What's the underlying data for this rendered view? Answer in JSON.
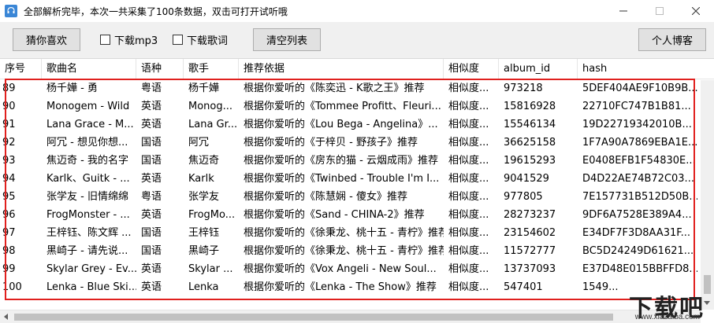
{
  "window": {
    "title": "全部解析完毕，本次一共采集了100条数据，双击可打开试听哦"
  },
  "toolbar": {
    "guess_label": "猜你喜欢",
    "download_mp3_label": "下载mp3",
    "download_mp3_checked": false,
    "download_lyrics_label": "下载歌词",
    "download_lyrics_checked": false,
    "clear_label": "清空列表",
    "blog_label": "个人博客"
  },
  "table": {
    "headers": {
      "index": "序号",
      "song": "歌曲名",
      "lang": "语种",
      "singer": "歌手",
      "basis": "推荐依据",
      "similarity": "相似度",
      "album_id": "album_id",
      "hash": "hash"
    },
    "rows": [
      {
        "index": "89",
        "song": "杨千嬅 - 勇",
        "lang": "粤语",
        "singer": "杨千嬅",
        "basis": "根据你爱听的《陈奕迅 - K歌之王》推荐",
        "similarity": "相似度...",
        "album_id": "973218",
        "hash": "5DEF404AE9F10B9B..."
      },
      {
        "index": "90",
        "song": "Monogem - Wild",
        "lang": "英语",
        "singer": "Monog...",
        "basis": "根据你爱听的《Tommee Profitt、Fleuri...",
        "similarity": "相似度...",
        "album_id": "15816928",
        "hash": "22710FC747B1B81..."
      },
      {
        "index": "91",
        "song": "Lana Grace - M...",
        "lang": "英语",
        "singer": "Lana Gr...",
        "basis": "根据你爱听的《Lou Bega - Angelina》...",
        "similarity": "相似度...",
        "album_id": "15546134",
        "hash": "19D22719342010B..."
      },
      {
        "index": "92",
        "song": "阿冗 - 想见你想...",
        "lang": "国语",
        "singer": "阿冗",
        "basis": "根据你爱听的《于梓贝 - 野孩子》推荐",
        "similarity": "相似度...",
        "album_id": "36625158",
        "hash": "1F7A90A7869EBA1E..."
      },
      {
        "index": "93",
        "song": "焦迈奇 - 我的名字",
        "lang": "国语",
        "singer": "焦迈奇",
        "basis": "根据你爱听的《房东的猫 - 云烟成雨》推荐",
        "similarity": "相似度...",
        "album_id": "19615293",
        "hash": "E0408EFB1F54830E..."
      },
      {
        "index": "94",
        "song": "Karlk、Guitk - ...",
        "lang": "英语",
        "singer": "Karlk",
        "basis": "根据你爱听的《Twinbed - Trouble I'm I...",
        "similarity": "相似度...",
        "album_id": "9041529",
        "hash": "D4D22AE74B72C03..."
      },
      {
        "index": "95",
        "song": "张学友 - 旧情绵绵",
        "lang": "粤语",
        "singer": "张学友",
        "basis": "根据你爱听的《陈慧娴 - 傻女》推荐",
        "similarity": "相似度...",
        "album_id": "977805",
        "hash": "7E157731B512D50B..."
      },
      {
        "index": "96",
        "song": "FrogMonster - ...",
        "lang": "英语",
        "singer": "FrogMo...",
        "basis": "根据你爱听的《Sand - CHINA-2》推荐",
        "similarity": "相似度...",
        "album_id": "28273237",
        "hash": "9DF6A7528E389A4..."
      },
      {
        "index": "97",
        "song": "王梓钰、陈文辉 ...",
        "lang": "国语",
        "singer": "王梓钰",
        "basis": "根据你爱听的《徐秉龙、桃十五 - 青柠》推荐",
        "similarity": "相似度...",
        "album_id": "23154602",
        "hash": "E34DF7F3D8AA31F..."
      },
      {
        "index": "98",
        "song": "黑崎子 - 请先说...",
        "lang": "国语",
        "singer": "黑崎子",
        "basis": "根据你爱听的《徐秉龙、桃十五 - 青柠》推荐",
        "similarity": "相似度...",
        "album_id": "11572777",
        "hash": "BC5D24249D61621..."
      },
      {
        "index": "99",
        "song": "Skylar Grey - Ev...",
        "lang": "英语",
        "singer": "Skylar ...",
        "basis": "根据你爱听的《Vox Angeli - New Soul...",
        "similarity": "相似度...",
        "album_id": "13737093",
        "hash": "E37D48E015BBFFD8..."
      },
      {
        "index": "100",
        "song": "Lenka - Blue Ski...",
        "lang": "英语",
        "singer": "Lenka",
        "basis": "根据你爱听的《Lenka - The Show》推荐",
        "similarity": "相似度...",
        "album_id": "547401",
        "hash": "1549..."
      }
    ]
  },
  "watermark": {
    "cn": "下载吧",
    "url": "www.xiazaiba.com"
  },
  "colors": {
    "highlight": "#e0201e",
    "app_icon": "#3a86d6"
  }
}
